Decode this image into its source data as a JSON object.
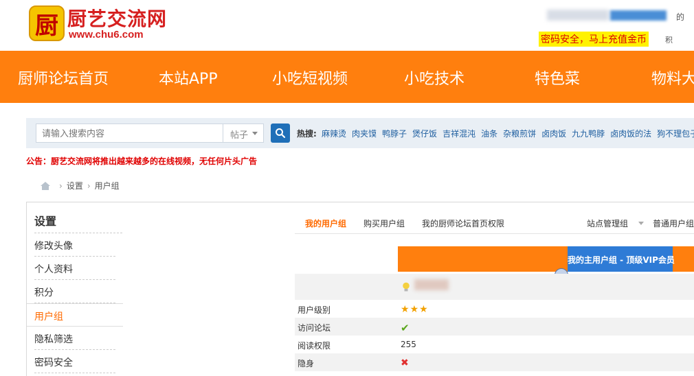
{
  "header": {
    "logo_glyph": "厨",
    "site_name": "厨艺交流网",
    "site_url": "www.chu6.com",
    "top_suffix": "的",
    "promo": "密码安全，马上充值金币",
    "promo_tail": "积"
  },
  "nav": [
    "厨师论坛首页",
    "本站APP",
    "小吃短视频",
    "小吃技术",
    "特色菜",
    "物料大"
  ],
  "search": {
    "placeholder": "请输入搜索内容",
    "type": "帖子",
    "hot_label": "热搜:",
    "hot_terms": [
      "麻辣烫",
      "肉夹馍",
      "鸭脖子",
      "煲仔饭",
      "吉祥混沌",
      "油条",
      "杂粮煎饼",
      "卤肉饭",
      "九九鸭脖",
      "卤肉饭的法",
      "狗不理包子"
    ]
  },
  "notice": "公告：厨艺交流网将推出越来越多的在线视频，无任何片头广告",
  "breadcrumb": [
    "设置",
    "用户组"
  ],
  "sidebar": {
    "title": "设置",
    "items": [
      "修改头像",
      "个人资料",
      "积分",
      "用户组",
      "隐私筛选",
      "密码安全"
    ],
    "active_index": 3
  },
  "tabs": {
    "items": [
      "我的用户组",
      "购买用户组",
      "我的厨师论坛首页权限"
    ],
    "right": [
      "站点管理组",
      "普通用户组"
    ]
  },
  "banner": {
    "label": "我的主用户组 - 顶级VIP会员"
  },
  "table": {
    "rows": [
      {
        "label": "用户级别",
        "stars": 3
      },
      {
        "label": "访问论坛",
        "icon": "check-icon"
      },
      {
        "label": "阅读权限",
        "value": "255"
      },
      {
        "label": "隐身",
        "icon": "cross-icon"
      }
    ]
  },
  "colors": {
    "brand_orange": "#ff7f0e",
    "brand_red": "#d61f1f",
    "blue": "#2e7bd6"
  }
}
